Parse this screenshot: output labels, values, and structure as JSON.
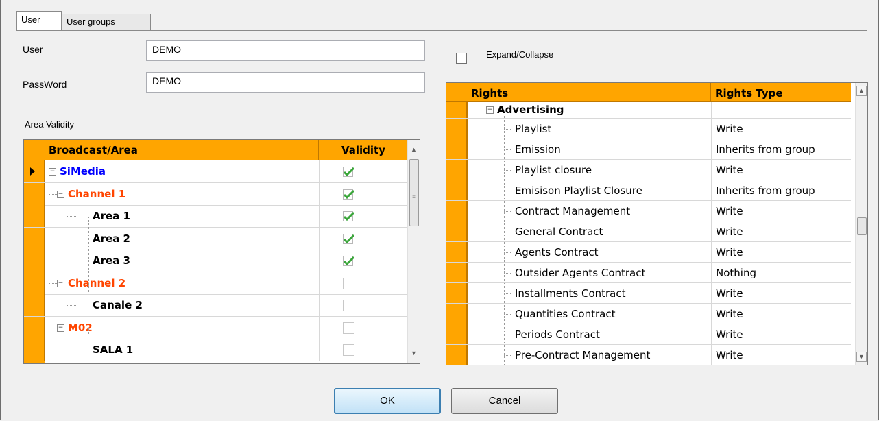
{
  "tabs": {
    "user": "User",
    "groups": "User groups"
  },
  "form": {
    "user_label": "User",
    "user_value": "DEMO",
    "password_label": "PassWord",
    "password_value": "DEMO",
    "area_validity_label": "Area Validity",
    "expand_label": "Expand/Collapse"
  },
  "area_grid": {
    "col_area": "Broadcast/Area",
    "col_validity": "Validity",
    "rows": [
      {
        "name": "SiMedia",
        "valid": true,
        "style": "blue",
        "level": 0,
        "expandable": true
      },
      {
        "name": "Channel 1",
        "valid": true,
        "style": "orange",
        "level": 1,
        "expandable": true
      },
      {
        "name": "Area 1",
        "valid": true,
        "style": "black",
        "level": 2,
        "expandable": false
      },
      {
        "name": "Area 2",
        "valid": true,
        "style": "black",
        "level": 2,
        "expandable": false
      },
      {
        "name": "Area 3",
        "valid": true,
        "style": "black",
        "level": 2,
        "expandable": false
      },
      {
        "name": "Channel 2",
        "valid": false,
        "style": "orange",
        "level": 1,
        "expandable": true
      },
      {
        "name": "Canale 2",
        "valid": false,
        "style": "black",
        "level": 2,
        "expandable": false
      },
      {
        "name": "M02",
        "valid": false,
        "style": "orange",
        "level": 1,
        "expandable": true
      },
      {
        "name": "SALA 1",
        "valid": false,
        "style": "black",
        "level": 2,
        "expandable": false
      }
    ]
  },
  "rights_grid": {
    "col_rights": "Rights",
    "col_type": "Rights Type",
    "group": "Advertising",
    "rows": [
      {
        "right": "Playlist",
        "type": "Write"
      },
      {
        "right": "Emission",
        "type": "Inherits from group"
      },
      {
        "right": "Playlist closure",
        "type": "Write"
      },
      {
        "right": "Emisison Playlist  Closure",
        "type": "Inherits from group"
      },
      {
        "right": "Contract Management",
        "type": "Write"
      },
      {
        "right": "General Contract",
        "type": "Write"
      },
      {
        "right": "Agents Contract",
        "type": "Write"
      },
      {
        "right": "Outsider Agents Contract",
        "type": "Nothing"
      },
      {
        "right": "Installments Contract",
        "type": "Write"
      },
      {
        "right": "Quantities Contract",
        "type": "Write"
      },
      {
        "right": "Periods Contract",
        "type": "Write"
      },
      {
        "right": "Pre-Contract Management",
        "type": "Write"
      }
    ]
  },
  "buttons": {
    "ok": "OK",
    "cancel": "Cancel"
  },
  "colors": {
    "header": "#ffa500",
    "blue": "#0000ff",
    "orange": "#ff4500"
  }
}
